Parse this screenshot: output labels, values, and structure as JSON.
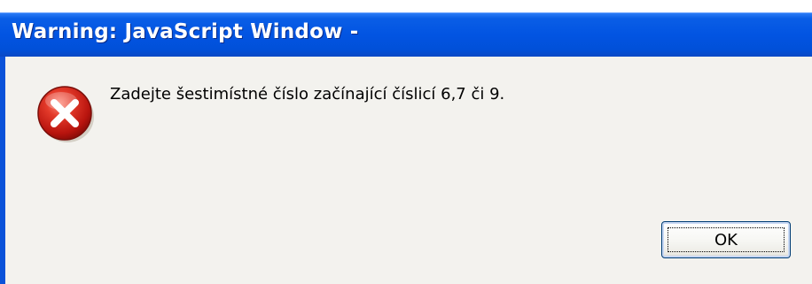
{
  "window": {
    "title": "Warning: JavaScript Window -"
  },
  "dialog": {
    "icon": "error-icon",
    "message": "Zadejte šestimístné číslo začínající číslicí 6,7 či 9.",
    "ok_label": "OK"
  },
  "colors": {
    "titlebar": "#0254e2",
    "body_background": "#f3f2ee",
    "error_red": "#d0231a"
  }
}
